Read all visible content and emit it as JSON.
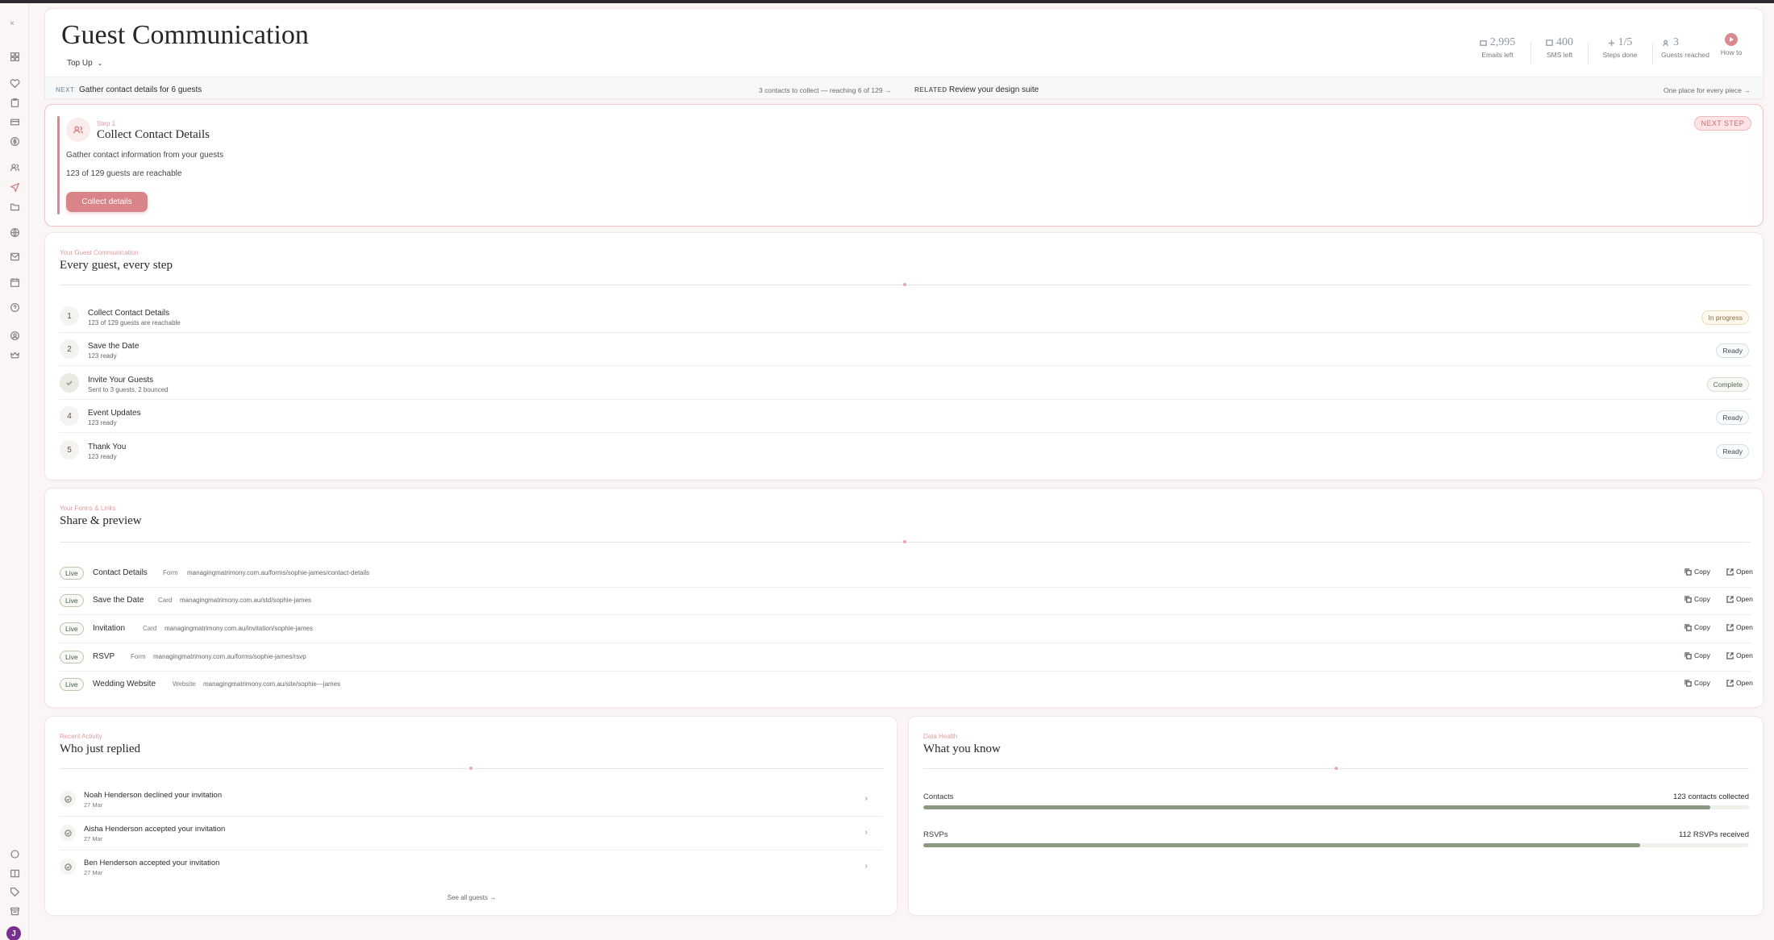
{
  "page": {
    "title": "Guest Communication",
    "dropdown": "Top Up"
  },
  "stats": [
    {
      "value": "2,995",
      "label": "Emails left",
      "icon": "mail-icon"
    },
    {
      "value": "400",
      "label": "SMS left",
      "icon": "message-icon"
    },
    {
      "value": "1/5",
      "label": "Steps done",
      "icon": "sparkle-icon"
    },
    {
      "value": "3",
      "label": "Guests reached",
      "icon": "users-icon"
    }
  ],
  "howto": {
    "label": "How to"
  },
  "next_bar": {
    "next_key": "NEXT",
    "next_text": "Gather contact details for 6 guests",
    "next_sub": "3 contacts to collect — reaching 6 of 129",
    "related_key": "RELATED",
    "related_text": "Review your design suite",
    "related_sub": "One place for every piece"
  },
  "current_step": {
    "step_label": "Step 1",
    "title": "Collect Contact Details",
    "description": "Gather contact information from your guests",
    "reach": "123 of 129 guests are reachable",
    "button": "Collect details",
    "badge": "NEXT STEP"
  },
  "communication": {
    "kicker": "Your Guest Communication",
    "title": "Every guest, every step",
    "steps": [
      {
        "num": "1",
        "title": "Collect Contact Details",
        "sub": "123 of 129 guests are reachable",
        "status": "In progress",
        "state": "progress"
      },
      {
        "num": "2",
        "title": "Save the Date",
        "sub": "123 ready",
        "status": "Ready",
        "state": "ready"
      },
      {
        "num": "",
        "title": "Invite Your Guests",
        "sub": "Sent to 3 guests, 2 bounced",
        "status": "Complete",
        "state": "complete"
      },
      {
        "num": "4",
        "title": "Event Updates",
        "sub": "123 ready",
        "status": "Ready",
        "state": "ready"
      },
      {
        "num": "5",
        "title": "Thank You",
        "sub": "123 ready",
        "status": "Ready",
        "state": "ready"
      }
    ]
  },
  "share": {
    "kicker": "Your Forms & Links",
    "title": "Share & preview",
    "copy_label": "Copy",
    "open_label": "Open",
    "links": [
      {
        "status": "Live",
        "name": "Contact Details",
        "type": "Form",
        "url": "managingmatrimony.com.au/forms/sophie-james/contact-details"
      },
      {
        "status": "Live",
        "name": "Save the Date",
        "type": "Card",
        "url": "managingmatrimony.com.au/std/sophie-james"
      },
      {
        "status": "Live",
        "name": "Invitation",
        "type": "Card",
        "url": "managingmatrimony.com.au/invitation/sophie-james"
      },
      {
        "status": "Live",
        "name": "RSVP",
        "type": "Form",
        "url": "managingmatrimony.com.au/forms/sophie-james/rsvp"
      },
      {
        "status": "Live",
        "name": "Wedding Website",
        "type": "Website",
        "url": "managingmatrimony.com.au/site/sophie---james"
      }
    ]
  },
  "recent": {
    "kicker": "Recent Activity",
    "title": "Who just replied",
    "items": [
      {
        "text": "Noah Henderson declined your invitation",
        "date": "27 Mar"
      },
      {
        "text": "Aisha Henderson accepted your invitation",
        "date": "27 Mar"
      },
      {
        "text": "Ben Henderson accepted your invitation",
        "date": "27 Mar"
      }
    ],
    "see_all": "See all guests →"
  },
  "health": {
    "kicker": "Data Health",
    "title": "What you know",
    "rows": [
      {
        "label": "Contacts",
        "value": "123 contacts collected",
        "fraction": 0.953
      },
      {
        "label": "RSVPs",
        "value": "112 RSVPs received",
        "fraction": 0.868
      }
    ]
  },
  "user": {
    "initial": "J"
  },
  "colors": {
    "accent": "#d98489",
    "sage": "#8a9a82"
  }
}
